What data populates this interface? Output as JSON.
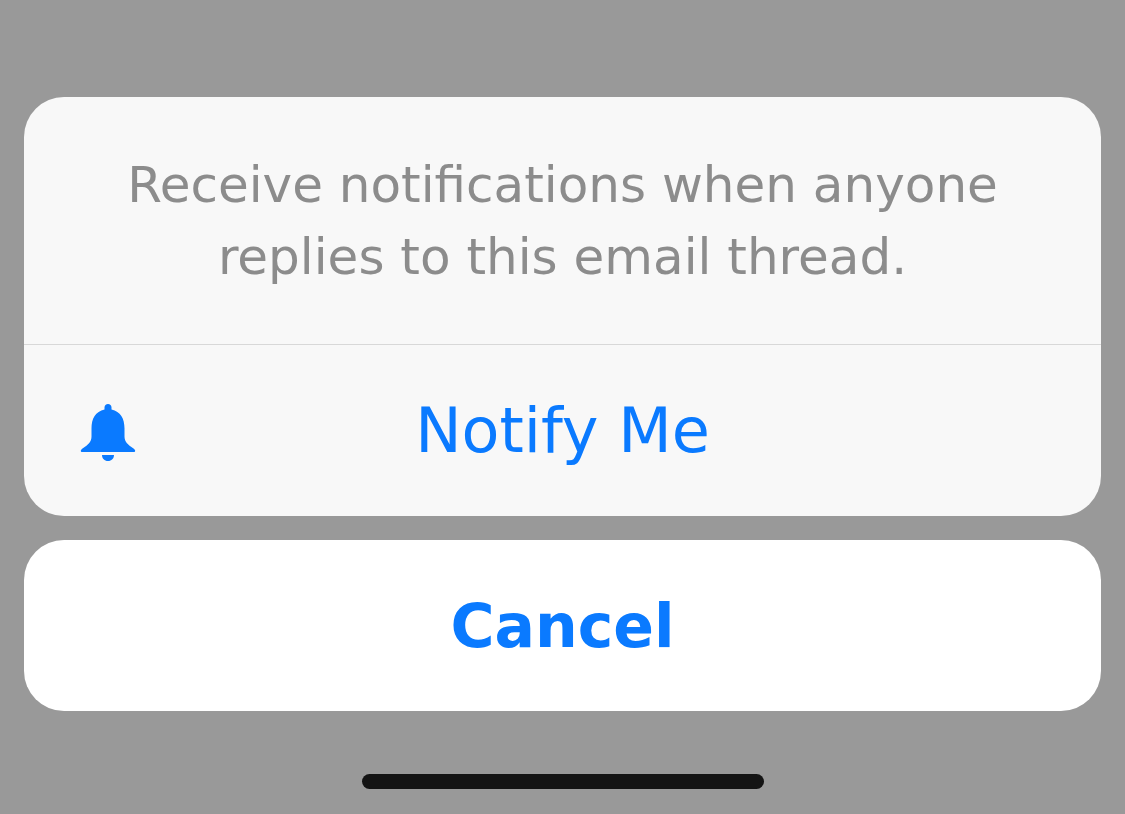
{
  "action_sheet": {
    "message": "Receive notifications when anyone replies to this email thread.",
    "actions": [
      {
        "label": "Notify Me"
      }
    ]
  },
  "cancel_button": {
    "label": "Cancel"
  }
}
